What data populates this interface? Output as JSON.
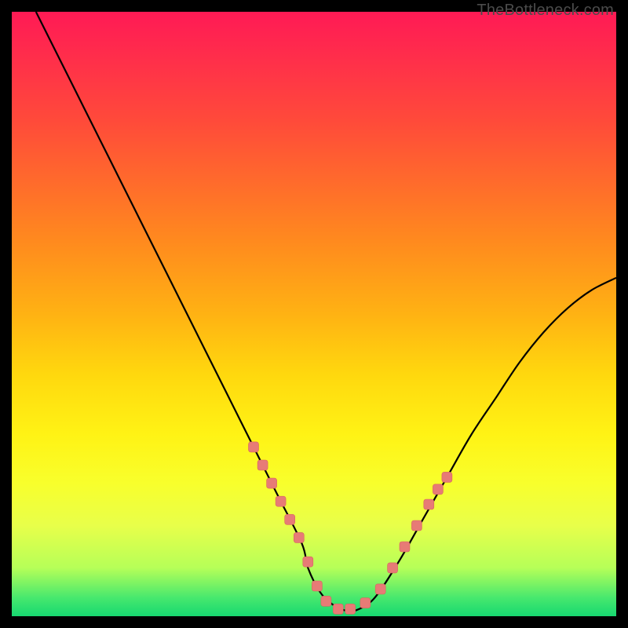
{
  "watermark": "TheBottleneck.com",
  "colors": {
    "background": "#000000",
    "curve_stroke": "#000000",
    "marker_fill": "#e77b76",
    "marker_stroke": "#d8645f"
  },
  "chart_data": {
    "type": "line",
    "title": "",
    "xlabel": "",
    "ylabel": "",
    "xlim": [
      0,
      100
    ],
    "ylim": [
      0,
      100
    ],
    "series": [
      {
        "name": "bottleneck-curve",
        "x": [
          4,
          8,
          12,
          16,
          20,
          24,
          28,
          32,
          36,
          40,
          44,
          48,
          49,
          51,
          53,
          55,
          57,
          60,
          64,
          68,
          72,
          76,
          80,
          84,
          88,
          92,
          96,
          100
        ],
        "y": [
          100,
          92,
          84,
          76,
          68,
          60,
          52,
          44,
          36,
          28,
          20,
          12,
          8,
          4,
          2,
          1,
          1,
          3,
          9,
          16,
          23,
          30,
          36,
          42,
          47,
          51,
          54,
          56
        ]
      }
    ],
    "markers": {
      "name": "highlighted-points",
      "x": [
        40,
        41.5,
        43,
        44.5,
        46,
        47.5,
        49,
        50.5,
        52,
        54,
        56,
        58.5,
        61,
        63,
        65,
        67,
        69,
        70.5,
        72
      ],
      "y": [
        28,
        25,
        22,
        19,
        16,
        13,
        9,
        5,
        2.5,
        1.2,
        1.2,
        2.2,
        4.5,
        8,
        11.5,
        15,
        18.5,
        21,
        23
      ]
    }
  }
}
